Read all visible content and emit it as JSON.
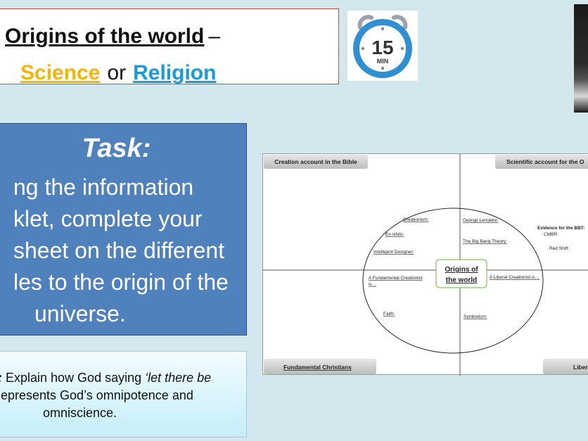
{
  "title": {
    "part1": "Origins of the world",
    "dash": "–",
    "science": "Science",
    "or": "or",
    "religion": "Religion"
  },
  "timer": {
    "number": "15",
    "unit": "MIN",
    "minutes": 15
  },
  "task": {
    "heading": "Task:",
    "lines": [
      "ng the information",
      "klet, complete your",
      "sheet on the different",
      "les to the origin of the",
      "universe."
    ]
  },
  "extension": {
    "prefix": ":",
    "line1_normal": " Explain how God saying ",
    "line1_italic": "‘let there be",
    "line2": "epresents God’s omnipotence and",
    "line3": "omniscience."
  },
  "diagram": {
    "tabs": {
      "top_left": "Creation account in the Bible",
      "top_right": "Scientific account for the O",
      "bottom_left": "Fundamental Christians",
      "bottom_right": "Liber"
    },
    "center": [
      "Origins of",
      "the world"
    ],
    "labels": {
      "creationism": "Creationism:",
      "ex_nihilo": "Ex nihilo:",
      "intelligent_designer": "Intelligent Designer:",
      "george_lemaitre": "George Lemaitre:",
      "big_bang": "The Big Bang Theory:",
      "fundamental_creationist_1": "A Fundamental Creationist",
      "fundamental_creationist_2": "is…",
      "liberal_creationist": "A Liberal Creationist is…",
      "faith": "Faith:",
      "symbolism": "Symbolism:",
      "evidence": "Evidence for the BBT:",
      "cmbr": "CMBR:",
      "red_shift": "Red Shift:"
    }
  },
  "colors": {
    "background": "#d3e8ee",
    "science": "#f2b705",
    "religion": "#1a9ad6",
    "task_box": "#4f81bd",
    "timer_ring": "#2f8fd0",
    "center_border": "#70ad47"
  }
}
